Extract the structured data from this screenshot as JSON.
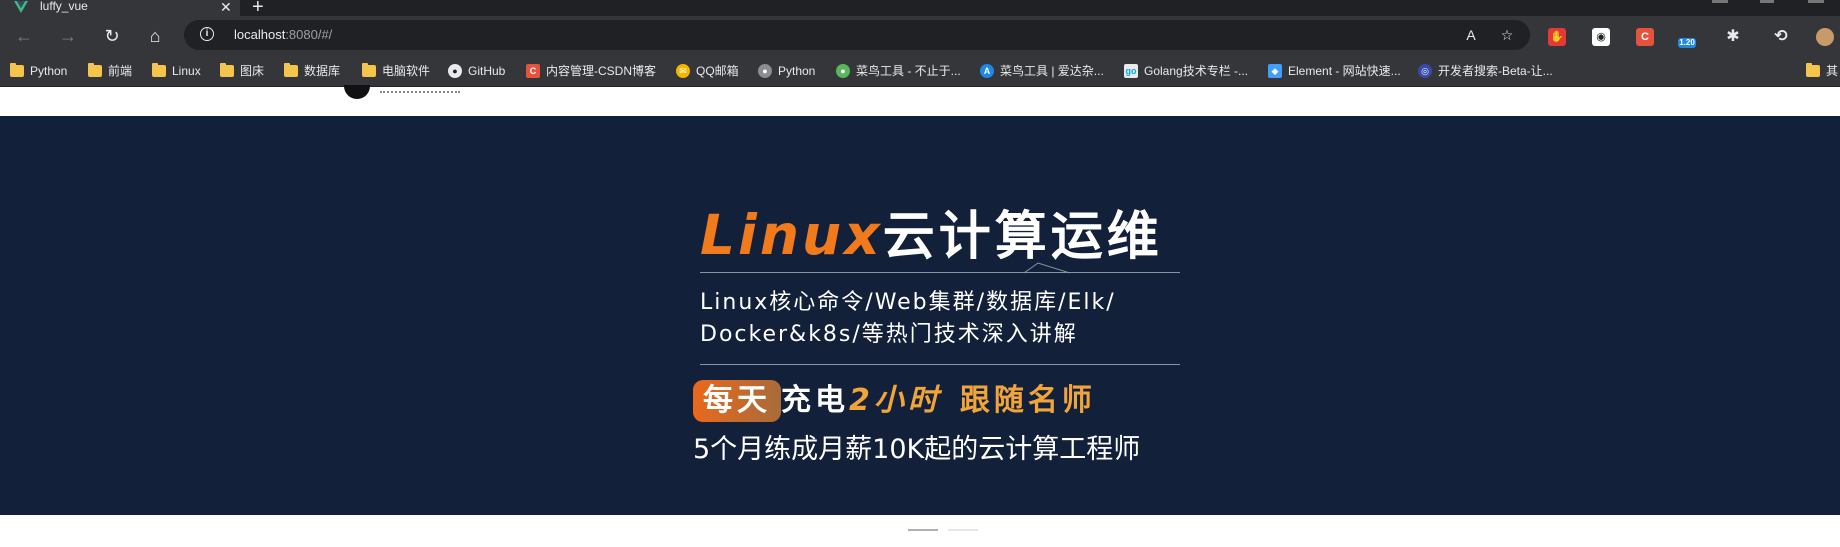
{
  "browser": {
    "tab": {
      "title": "luffy_vue",
      "close_glyph": "✕",
      "new_tab_glyph": "+"
    },
    "nav": {
      "back_glyph": "←",
      "forward_glyph": "→",
      "reload_glyph": "↻",
      "home_glyph": "⌂"
    },
    "address": {
      "host": "localhost",
      "rest": ":8080/#/",
      "info_glyph": "i"
    },
    "omnibox_icons": {
      "read_aloud_glyph": "A",
      "favorite_glyph": "☆"
    },
    "extensions": [
      {
        "name": "adblock-icon",
        "glyph": "✋",
        "color": "#e53935"
      },
      {
        "name": "reader-extension-icon",
        "glyph": "◉",
        "color": "#ffffff"
      },
      {
        "name": "csdn-extension-icon",
        "glyph": "C",
        "color": "#e5533d"
      },
      {
        "name": "download-extension-icon",
        "glyph": "",
        "badge": "1.20",
        "color": "#1e88e5"
      },
      {
        "name": "extensions-puzzle-icon",
        "glyph": "✱",
        "color": "#e8eaed"
      },
      {
        "name": "history-icon",
        "glyph": "⟲",
        "color": "#e8eaed"
      }
    ],
    "bookmarks": [
      {
        "label": "Python",
        "icon": "folder"
      },
      {
        "label": "前端",
        "icon": "folder"
      },
      {
        "label": "Linux",
        "icon": "folder"
      },
      {
        "label": "图床",
        "icon": "folder"
      },
      {
        "label": "数据库",
        "icon": "folder"
      },
      {
        "label": "电脑软件",
        "icon": "folder"
      },
      {
        "label": "GitHub",
        "icon": "github"
      },
      {
        "label": "内容管理-CSDN博客",
        "icon": "csdn"
      },
      {
        "label": "QQ邮箱",
        "icon": "qqmail"
      },
      {
        "label": "Python",
        "icon": "python"
      },
      {
        "label": "菜鸟工具 - 不止于...",
        "icon": "runoob"
      },
      {
        "label": "菜鸟工具 | 爱达杂...",
        "icon": "runoob-a"
      },
      {
        "label": "Golang技术专栏 -...",
        "icon": "golang"
      },
      {
        "label": "Element - 网站快速...",
        "icon": "element"
      },
      {
        "label": "开发者搜索-Beta-让...",
        "icon": "devsearch"
      },
      {
        "label": "其",
        "icon": "folder"
      }
    ]
  },
  "banner": {
    "headline_linux": "Linux",
    "headline_title": "云计算运维",
    "subtitle_line1": "Linux核心命令/Web集群/数据库/Elk/",
    "subtitle_line2": "Docker&k8s/等热门技术深入讲解",
    "promo_badge": "每天",
    "promo_white": "充电",
    "promo_orange_1": "2小时",
    "promo_orange_2": "跟随名师",
    "tagline": "5个月练成月薪10K起的云计算工程师",
    "colors": {
      "background": "#13203a",
      "accent_orange": "#f07a1c",
      "promo_orange": "#f0a43a"
    }
  }
}
